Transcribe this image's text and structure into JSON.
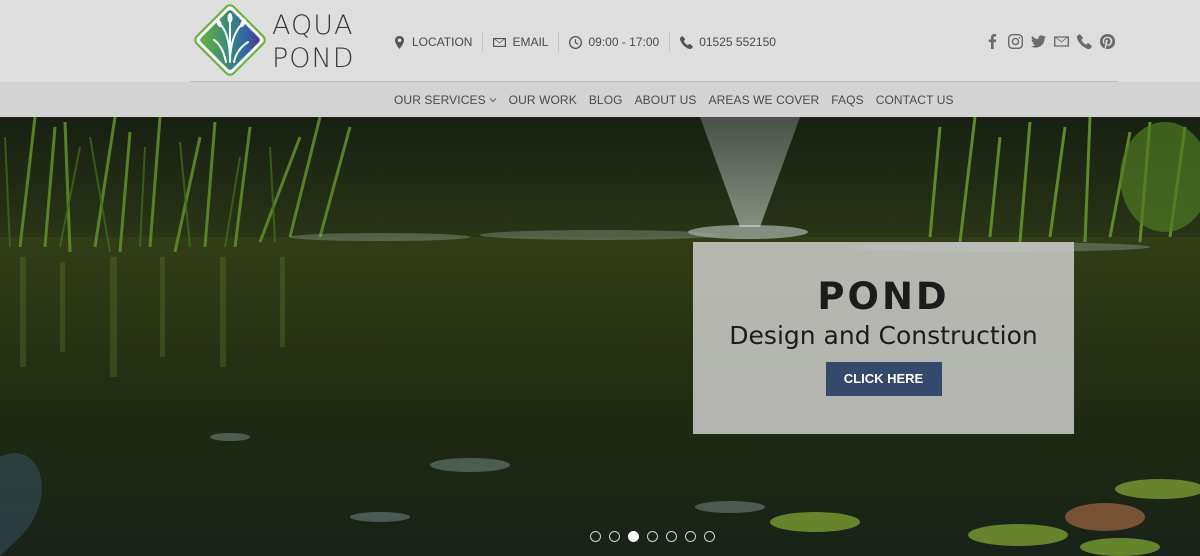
{
  "brand": {
    "name_line1": "AQUA",
    "name_line2": "POND",
    "colors": {
      "green": "#6ab23e",
      "purple": "#5a2f86",
      "blue": "#2f68a8"
    }
  },
  "top_bar": {
    "location": {
      "icon": "map-pin-icon",
      "label": "LOCATION"
    },
    "email": {
      "icon": "envelope-icon",
      "label": "EMAIL"
    },
    "hours": {
      "icon": "clock-icon",
      "label": "09:00 - 17:00"
    },
    "phone": {
      "icon": "phone-icon",
      "label": "01525 552150"
    }
  },
  "social": [
    "facebook-icon",
    "instagram-icon",
    "twitter-icon",
    "email-icon",
    "phone-icon",
    "pinterest-icon"
  ],
  "nav": {
    "items": [
      "OUR SERVICES",
      "OUR WORK",
      "BLOG",
      "ABOUT US",
      "AREAS WE COVER",
      "FAQS",
      "CONTACT US"
    ]
  },
  "hero": {
    "title": "POND",
    "subtitle": "Design and Construction",
    "button": "CLICK HERE",
    "button_color": "#34496b",
    "slides_total": 7,
    "active_slide": 3
  }
}
